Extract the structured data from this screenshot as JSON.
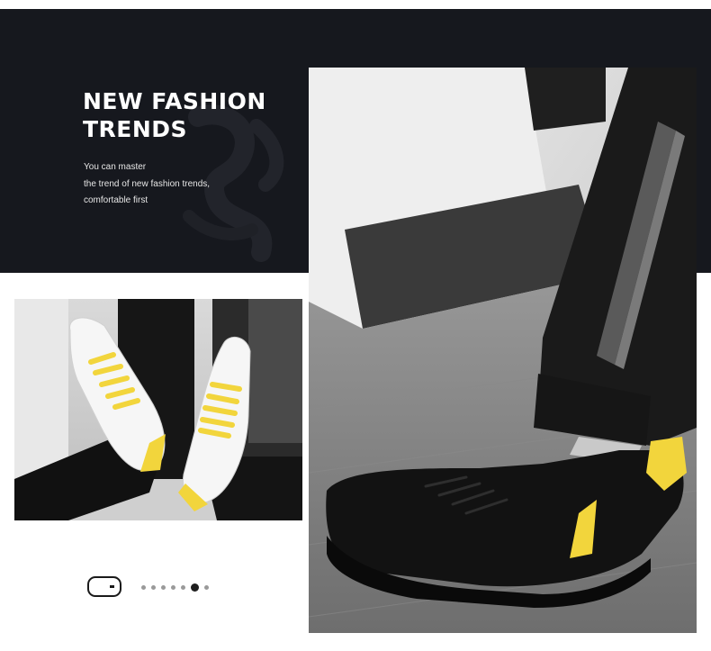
{
  "hero": {
    "headline_line1": "NEW FASHION",
    "headline_line2": "TRENDS",
    "sub_line1": "You can master",
    "sub_line2": "the trend of new fashion trends,",
    "sub_line3": "comfortable first",
    "background_color": "#16181e"
  },
  "images": {
    "small": "white-sneakers-yellow-laces-photo",
    "large": "black-leather-sneaker-yellow-heel-photo"
  },
  "pager": {
    "toggle_icon": "toggle-switch-icon",
    "dot_count": 7,
    "active_index": 5
  },
  "colors": {
    "accent": "#f2d53c",
    "dark": "#16181e"
  }
}
